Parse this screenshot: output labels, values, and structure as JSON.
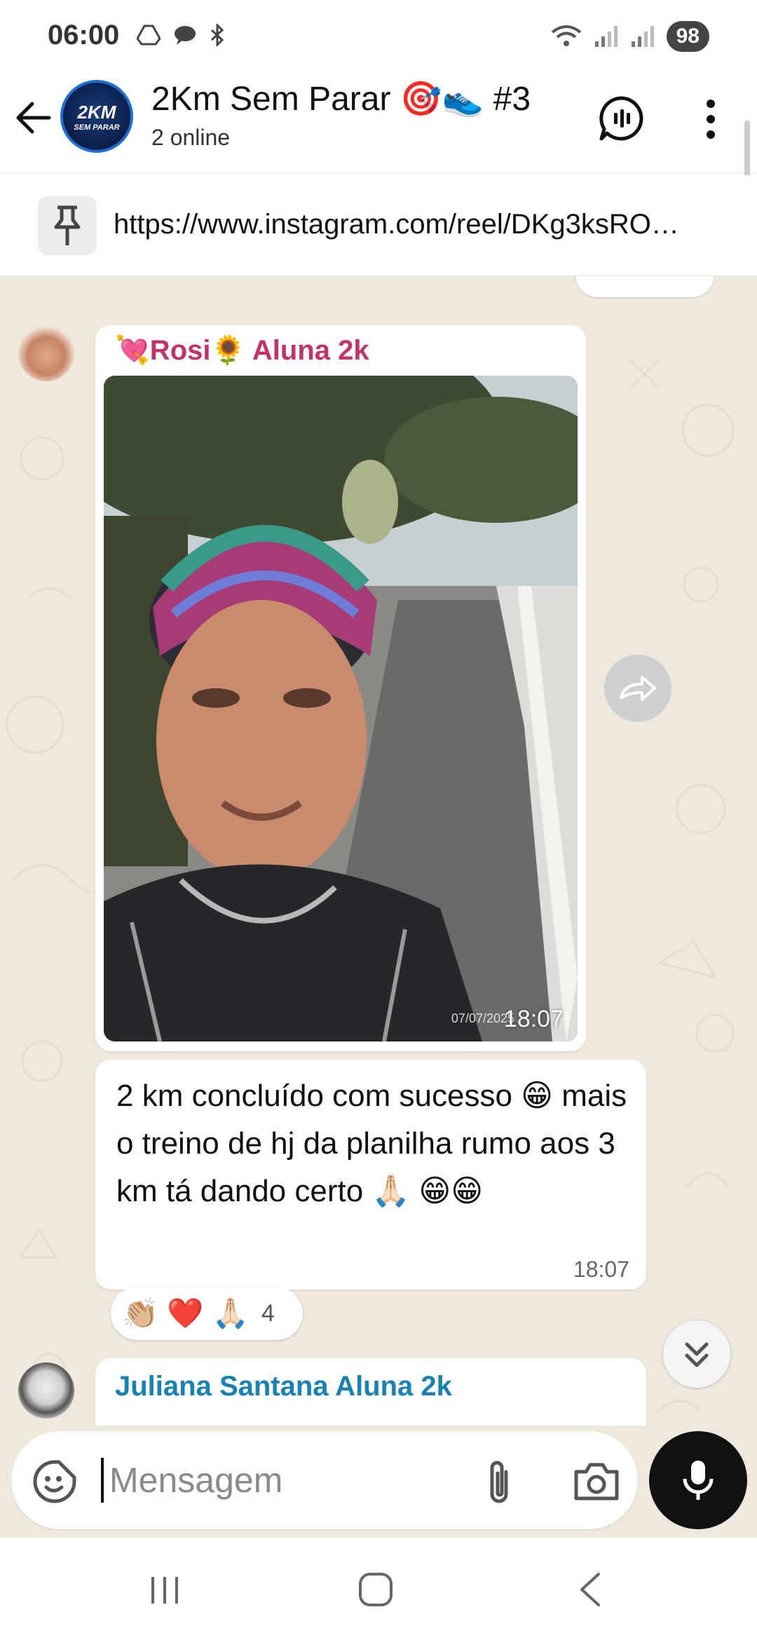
{
  "status_bar": {
    "time": "06:00",
    "battery": "98"
  },
  "header": {
    "group_avatar_line1": "2KM",
    "group_avatar_line2": "SEM PARAR",
    "title": "2Km Sem Parar 🎯👟 #3",
    "subtitle": "2 online"
  },
  "pinned": {
    "text": "https://www.instagram.com/reel/DKg3ksRO…"
  },
  "messages": {
    "media": {
      "sender": "💘Rosi🌻 Aluna 2k",
      "photo_date": "07/07/2025",
      "time": "18:07"
    },
    "text_message": {
      "text": "2 km concluído com sucesso 😁 mais o treino de hj da planilha rumo aos 3 km tá dando certo 🙏🏻 😁😁",
      "time": "18:07",
      "reactions": [
        "👏🏼",
        "❤️",
        "🙏🏻"
      ],
      "reaction_count": "4"
    },
    "next": {
      "sender": "Juliana Santana Aluna 2k"
    }
  },
  "input": {
    "placeholder": "Mensagem"
  },
  "colors": {
    "chat_bg": "#efe8dd",
    "rosi_name": "#c2336b",
    "juliana_name": "#1883b3"
  }
}
